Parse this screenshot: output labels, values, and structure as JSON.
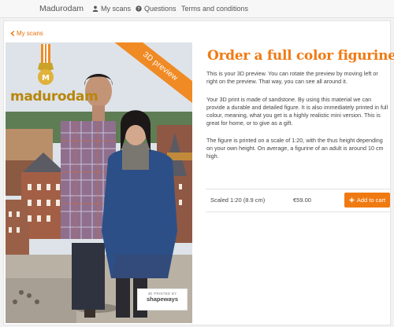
{
  "nav": {
    "brand": "Madurodam",
    "items": [
      {
        "label": "My scans",
        "icon": "user-icon"
      },
      {
        "label": "Questions",
        "icon": "question-circle-icon"
      },
      {
        "label": "Terms and conditions",
        "icon": ""
      }
    ]
  },
  "back_link": "My scans",
  "preview": {
    "ribbon": "3D preview",
    "logo_text": "madurodam",
    "badge_small": "3D PRINTED BY",
    "badge_big": "shapeways"
  },
  "product": {
    "title": "Order a full color figurine",
    "paragraphs": [
      "This is your 3D preview. You can rotate the preview by moving left or right on the preview. That way, you can see all around it.",
      "Your 3D print is made of sandstone. By using this material we can provide a durable and detailed figure. It is also immediately printed in full colour, meaning, what you get is a highly realistic mini version. This is great for home, or to give as a gift.",
      "The figure is printed on a scale of 1:20, with the thus height depending on your own height. On average, a figurine of an adult is around 10 cm high."
    ],
    "scale": "Scaled 1:20 (8.9 cm)",
    "price": "€59.00",
    "cart_button": "Add to cart"
  },
  "colors": {
    "accent": "#f07a12",
    "nav_bg": "#f7f7f7",
    "logo_gold": "#b8860b"
  }
}
